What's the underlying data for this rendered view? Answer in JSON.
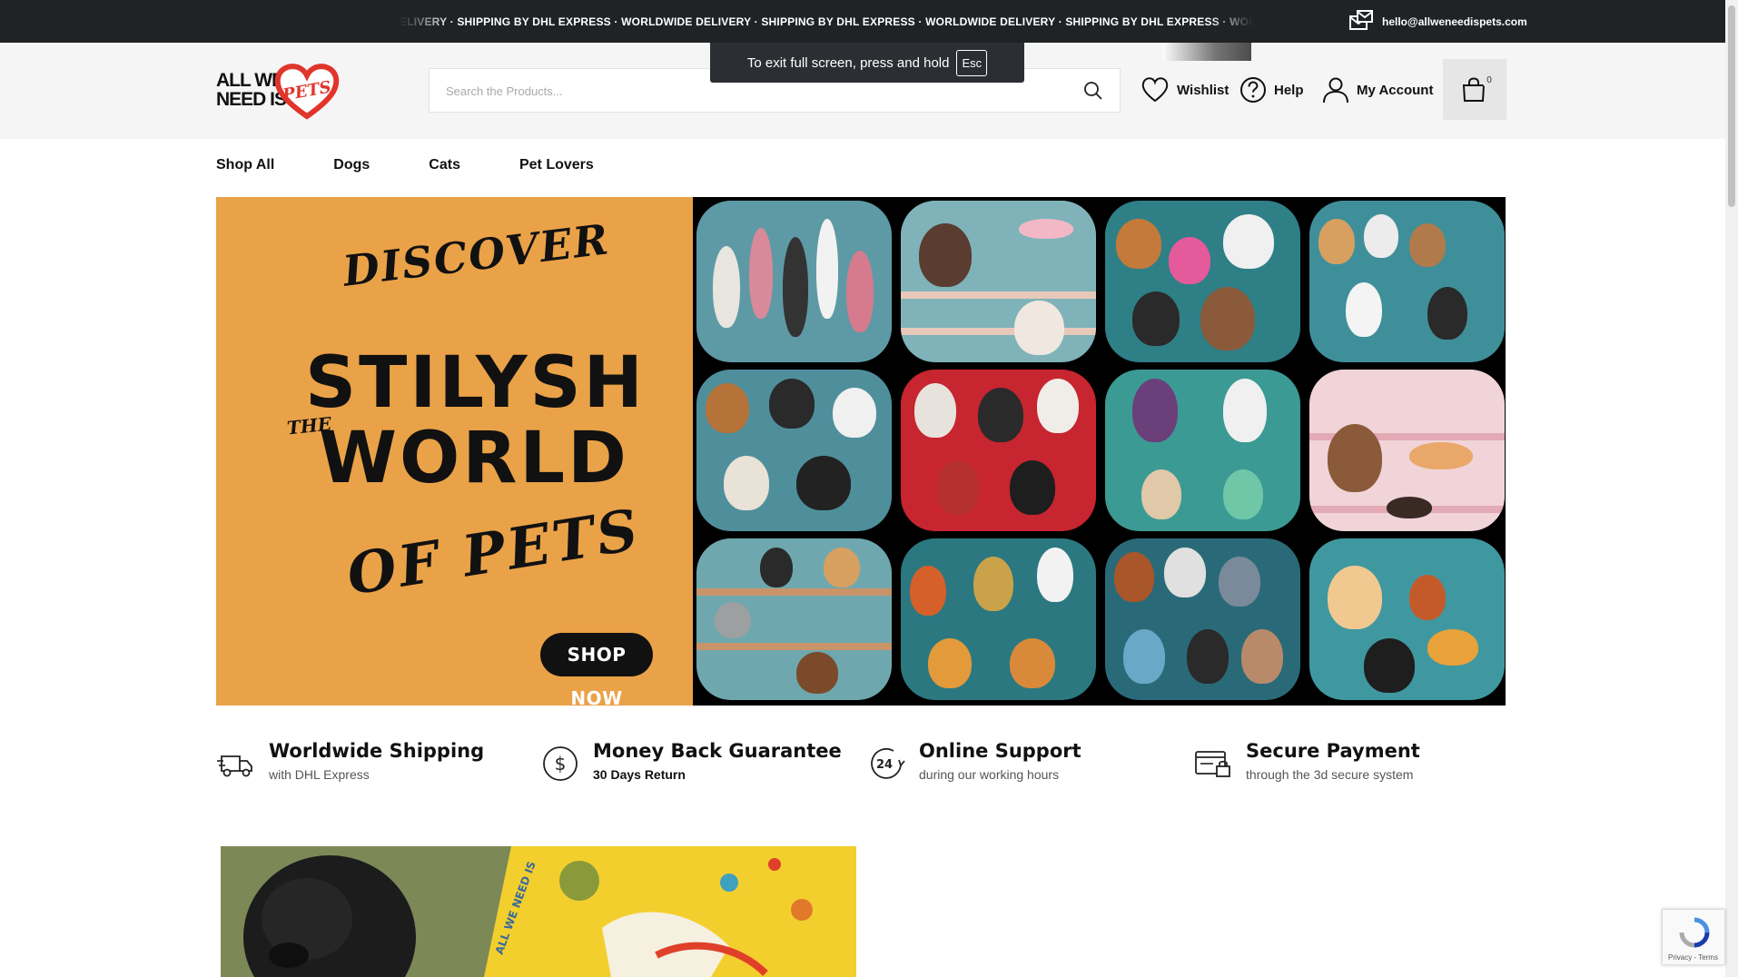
{
  "topbar": {
    "marquee": "ELIVERY · SHIPPING BY DHL EXPRESS · WORLDWIDE DELIVERY · SHIPPING BY DHL EXPRESS · WORLDWIDE DELIVERY · SHIPPING BY DHL EXPRESS · WORLDWIDE DEI",
    "email": "hello@allweneedispets.com"
  },
  "fullscreen_toast": {
    "message": "To exit full screen, press and hold",
    "key": "Esc"
  },
  "logo": {
    "line1": "ALL WE",
    "line2": "NEED IS",
    "heart_word": "PETS"
  },
  "search": {
    "placeholder": "Search the Products..."
  },
  "header_links": {
    "wishlist": "Wishlist",
    "help": "Help",
    "account": "My Account"
  },
  "cart": {
    "count": "0"
  },
  "nav": {
    "items": [
      "Shop All",
      "Dogs",
      "Cats",
      "Pet Lovers"
    ]
  },
  "hero": {
    "discover": "DISCOVER",
    "stilysh": "STILYSH",
    "the": "THE",
    "world": "WORLD",
    "of_pets": "OF PETS",
    "cta": "SHOP NOW"
  },
  "features": [
    {
      "title": "Worldwide Shipping",
      "subtitle": "with DHL Express",
      "icon": "truck-icon"
    },
    {
      "title": "Money Back Guarantee",
      "subtitle": "30 Days Return",
      "icon": "dollar-circle-icon"
    },
    {
      "title": "Online Support",
      "subtitle": "during our working hours",
      "icon": "support-24-icon"
    },
    {
      "title": "Secure Payment",
      "subtitle": "through the 3d secure system",
      "icon": "secure-card-icon"
    }
  ],
  "recaptcha": {
    "label": "Privacy - Terms"
  },
  "colors": {
    "topbar": "#1f2326",
    "hero_orange": "#eaa248",
    "logo_red": "#e0352b"
  }
}
